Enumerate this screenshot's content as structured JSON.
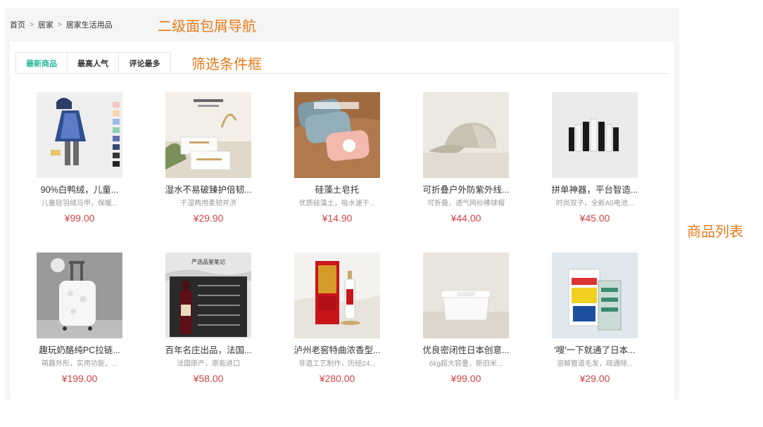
{
  "breadcrumb": {
    "items": [
      "首页",
      "居家",
      "居家生活用品"
    ],
    "separator": ">"
  },
  "tabs": [
    {
      "label": "最新商品",
      "active": true
    },
    {
      "label": "最高人气",
      "active": false
    },
    {
      "label": "评论最多",
      "active": false
    }
  ],
  "annotations": {
    "breadcrumb": "二级面包屑导航",
    "filter": "筛选条件框",
    "list": "商品列表"
  },
  "colors": {
    "accent": "#27ba9b",
    "price": "#cf4444",
    "annotation": "#e87a1b"
  },
  "products": [
    {
      "name": "90%白鸭绒，儿童...",
      "desc": "儿童轻羽绒马甲，保暖...",
      "price": "¥99.00",
      "image": "kids-down-vest"
    },
    {
      "name": "湿水不易破臻护倍韧...",
      "desc": "干湿两用柔韧并济",
      "price": "¥29.90",
      "image": "tissue-packs"
    },
    {
      "name": "硅藻土皂托",
      "desc": "优质硅藻土，吸水速干...",
      "price": "¥14.90",
      "image": "soap-tray"
    },
    {
      "name": "可折叠户外防紫外线...",
      "desc": "可折叠，透气网纱棒球帽",
      "price": "¥44.00",
      "image": "folding-cap"
    },
    {
      "name": "拼单神器，平台智造...",
      "desc": "时尚双子，全新A5电池...",
      "price": "¥45.00",
      "image": "batteries"
    },
    {
      "name": "趣玩奶酪纯PC拉链...",
      "desc": "萌趣外形，实用功能，...",
      "price": "¥199.00",
      "image": "suitcase"
    },
    {
      "name": "百年名庄出品，法国...",
      "desc": "法国原产，原瓶进口",
      "price": "¥58.00",
      "image": "wine-bottle",
      "image_text": "严选品鉴笔记"
    },
    {
      "name": "泸州老窖特曲浓香型...",
      "desc": "非遗工艺制作，历经24...",
      "price": "¥280.00",
      "image": "baijiu-box"
    },
    {
      "name": "优良密闭性日本创意...",
      "desc": "6kg超大容量，新旧米...",
      "price": "¥99.00",
      "image": "rice-container"
    },
    {
      "name": "'嗖'一下就通了日本...",
      "desc": "溶解管道毛发，疏通除...",
      "price": "¥29.00",
      "image": "drain-cleaner"
    }
  ]
}
